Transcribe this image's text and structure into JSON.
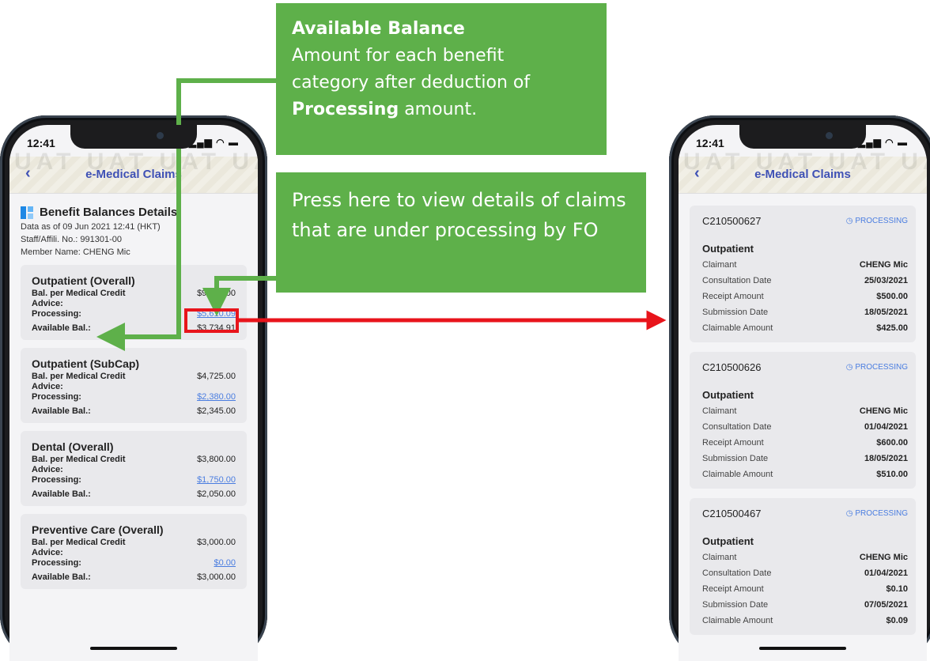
{
  "left_phone": {
    "time": "12:41",
    "title": "e-Medical Claims",
    "watermark_text": "UAT UAT UAT UAT",
    "section_title": "Benefit Balances Details",
    "meta_date": "Data as of 09 Jun 2021 12:41 (HKT)",
    "meta_staff": "Staff/Affili. No.: 991301-00",
    "meta_member": "Member Name:  CHENG Mic",
    "labels": {
      "bal": "Bal. per Medical Credit",
      "advice": "Advice:",
      "processing": "Processing:",
      "available": "Available Bal.:"
    },
    "cards": [
      {
        "title": "Outpatient (Overall)",
        "bal": "$9,345.00",
        "processing": "$5,610.09",
        "available": "$3,734.91"
      },
      {
        "title": "Outpatient (SubCap)",
        "bal": "$4,725.00",
        "processing": "$2,380.00",
        "available": "$2,345.00"
      },
      {
        "title": "Dental (Overall)",
        "bal": "$3,800.00",
        "processing": "$1,750.00",
        "available": "$2,050.00"
      },
      {
        "title": "Preventive Care (Overall)",
        "bal": "$3,000.00",
        "processing": "$0.00",
        "available": "$3,000.00"
      }
    ]
  },
  "right_phone": {
    "time": "12:41",
    "title": "e-Medical Claims",
    "watermark_text": "UAT UAT UAT UAT",
    "labels": {
      "claimant": "Claimant",
      "consultation": "Consultation Date",
      "receipt": "Receipt Amount",
      "submission": "Submission Date",
      "claimable": "Claimable Amount"
    },
    "claims": [
      {
        "id": "C210500627",
        "status": "PROCESSING",
        "type": "Outpatient",
        "claimant": "CHENG Mic",
        "consultation": "25/03/2021",
        "receipt": "$500.00",
        "submission": "18/05/2021",
        "claimable": "$425.00"
      },
      {
        "id": "C210500626",
        "status": "PROCESSING",
        "type": "Outpatient",
        "claimant": "CHENG Mic",
        "consultation": "01/04/2021",
        "receipt": "$600.00",
        "submission": "18/05/2021",
        "claimable": "$510.00"
      },
      {
        "id": "C210500467",
        "status": "PROCESSING",
        "type": "Outpatient",
        "claimant": "CHENG Mic",
        "consultation": "01/04/2021",
        "receipt": "$0.10",
        "submission": "07/05/2021",
        "claimable": "$0.09"
      }
    ]
  },
  "callouts": {
    "balance_title": "Available Balance",
    "balance_line1": "Amount for each benefit",
    "balance_line2": "category after deduction of",
    "balance_bold": "Processing",
    "balance_tail": " amount.",
    "press_text": "Press here to view details of claims that are under processing by FO"
  },
  "colors": {
    "callout_green": "#5eb04a",
    "highlight_red": "#e8141b",
    "link_blue": "#4a7de0",
    "header_blue": "#3f51b5"
  }
}
